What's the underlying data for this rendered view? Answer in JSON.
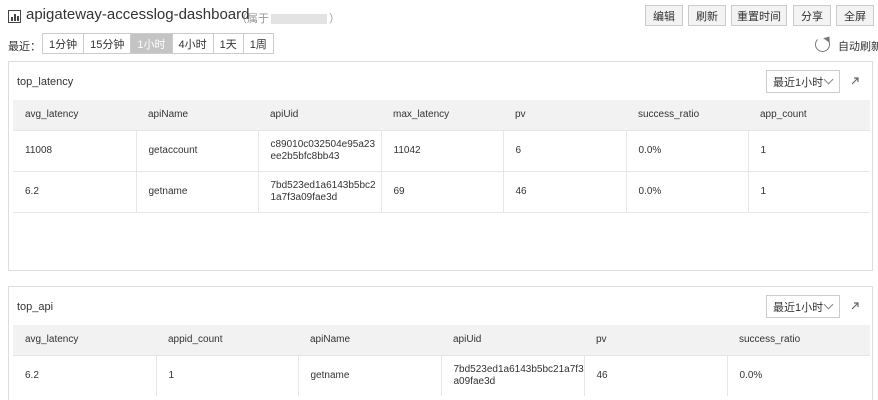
{
  "header": {
    "title": "apigateway-accesslog-dashboard",
    "owner_prefix": "（属于",
    "owner_suffix": "）",
    "buttons": {
      "edit": "编辑",
      "refresh": "刷新",
      "reset_time": "重置时间",
      "share": "分享",
      "fullscreen": "全屏"
    }
  },
  "timebar": {
    "label": "最近：",
    "options": [
      "1分钟",
      "15分钟",
      "1小时",
      "4小时",
      "1天",
      "1周"
    ],
    "selected": "1小时",
    "auto_refresh": "自动刷新"
  },
  "panels": [
    {
      "title": "top_latency",
      "range": "最近1小时",
      "columns": [
        "avg_latency",
        "apiName",
        "apiUid",
        "max_latency",
        "pv",
        "success_ratio",
        "app_count"
      ],
      "rows": [
        [
          "11008",
          "getaccount",
          "c89010c032504e95a23\nee2b5bfc8bb43",
          "11042",
          "6",
          "0.0%",
          "1"
        ],
        [
          "6.2",
          "getname",
          "7bd523ed1a6143b5bc2\n1a7f3a09fae3d",
          "69",
          "46",
          "0.0%",
          "1"
        ]
      ]
    },
    {
      "title": "top_api",
      "range": "最近1小时",
      "columns": [
        "avg_latency",
        "appid_count",
        "apiName",
        "apiUid",
        "pv",
        "success_ratio"
      ],
      "rows": [
        [
          "6.2",
          "1",
          "getname",
          "7bd523ed1a6143b5bc21a7f3\na09fae3d",
          "46",
          "0.0%"
        ]
      ]
    }
  ]
}
